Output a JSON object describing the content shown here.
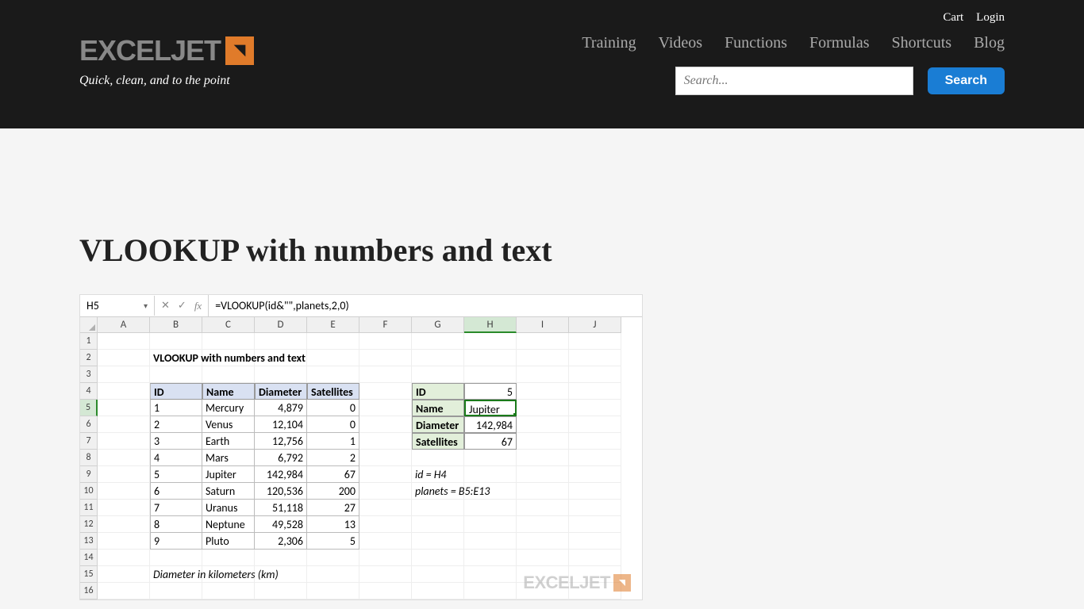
{
  "topbar": {
    "cart": "Cart",
    "login": "Login"
  },
  "logo": {
    "text": "EXCELJET",
    "tagline": "Quick, clean, and to the point"
  },
  "nav": {
    "training": "Training",
    "videos": "Videos",
    "functions": "Functions",
    "formulas": "Formulas",
    "shortcuts": "Shortcuts",
    "blog": "Blog"
  },
  "search": {
    "placeholder": "Search...",
    "button": "Search"
  },
  "page": {
    "title": "VLOOKUP with numbers and text"
  },
  "excel": {
    "nameBox": "H5",
    "formula": "=VLOOKUP(id&\"\",planets,2,0)",
    "cols": [
      "A",
      "B",
      "C",
      "D",
      "E",
      "F",
      "G",
      "H",
      "I",
      "J"
    ],
    "rows": [
      "1",
      "2",
      "3",
      "4",
      "5",
      "6",
      "7",
      "8",
      "9",
      "10",
      "11",
      "12",
      "13",
      "14",
      "15",
      "16"
    ],
    "sheetTitle": "VLOOKUP with numbers and text",
    "headers": {
      "id": "ID",
      "name": "Name",
      "diameter": "Diameter",
      "satellites": "Satellites"
    },
    "planets": [
      {
        "id": "1",
        "name": "Mercury",
        "diameter": "4,879",
        "sat": "0"
      },
      {
        "id": "2",
        "name": "Venus",
        "diameter": "12,104",
        "sat": "0"
      },
      {
        "id": "3",
        "name": "Earth",
        "diameter": "12,756",
        "sat": "1"
      },
      {
        "id": "4",
        "name": "Mars",
        "diameter": "6,792",
        "sat": "2"
      },
      {
        "id": "5",
        "name": "Jupiter",
        "diameter": "142,984",
        "sat": "67"
      },
      {
        "id": "6",
        "name": "Saturn",
        "diameter": "120,536",
        "sat": "200"
      },
      {
        "id": "7",
        "name": "Uranus",
        "diameter": "51,118",
        "sat": "27"
      },
      {
        "id": "8",
        "name": "Neptune",
        "diameter": "49,528",
        "sat": "13"
      },
      {
        "id": "9",
        "name": "Pluto",
        "diameter": "2,306",
        "sat": "5"
      }
    ],
    "lookup": {
      "idLabel": "ID",
      "idVal": "5",
      "nameLabel": "Name",
      "nameVal": "Jupiter",
      "diaLabel": "Diameter",
      "diaVal": "142,984",
      "satLabel": "Satellites",
      "satVal": "67"
    },
    "notes": {
      "n1": "id = H4",
      "n2": "planets = B5:E13",
      "footer": "Diameter in kilometers (km)"
    },
    "watermark": "EXCELJET"
  }
}
